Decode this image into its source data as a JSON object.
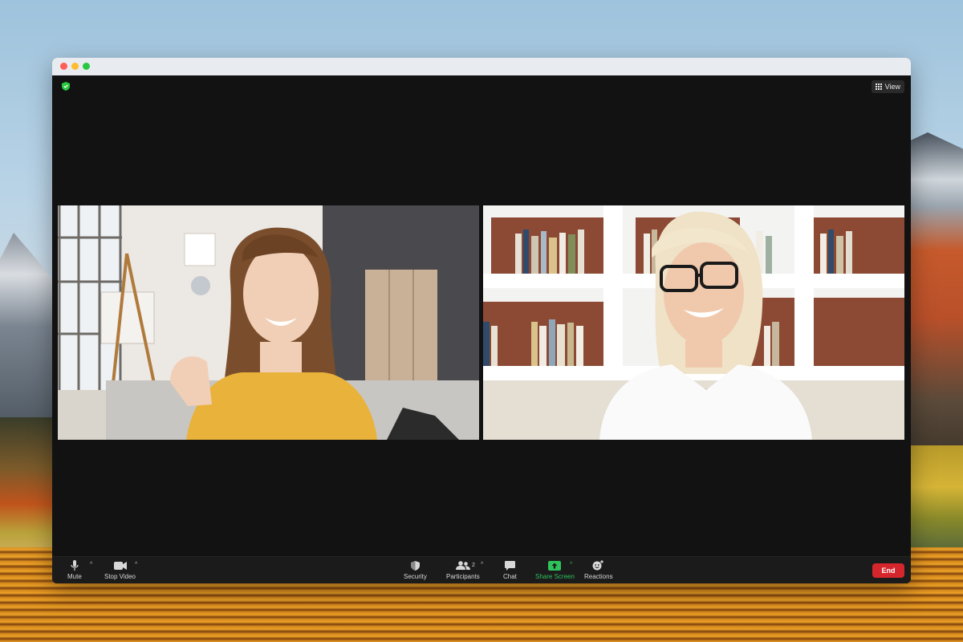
{
  "window": {
    "controls": [
      "close",
      "minimize",
      "zoom"
    ]
  },
  "meeting": {
    "security_indicator": "encrypted-shield-icon",
    "view_label": "View",
    "participants": [
      {
        "tile": "left",
        "description_icon": "video-feed"
      },
      {
        "tile": "right",
        "description_icon": "video-feed"
      }
    ]
  },
  "toolbar": {
    "mute_label": "Mute",
    "stop_video_label": "Stop Video",
    "security_label": "Security",
    "participants_label": "Participants",
    "participants_count": "2",
    "chat_label": "Chat",
    "share_screen_label": "Share Screen",
    "reactions_label": "Reactions",
    "end_label": "End"
  },
  "colors": {
    "window_bg": "#121212",
    "toolbar_bg": "#1b1b1b",
    "share_green": "#2fc15a",
    "end_red": "#d4262c"
  }
}
